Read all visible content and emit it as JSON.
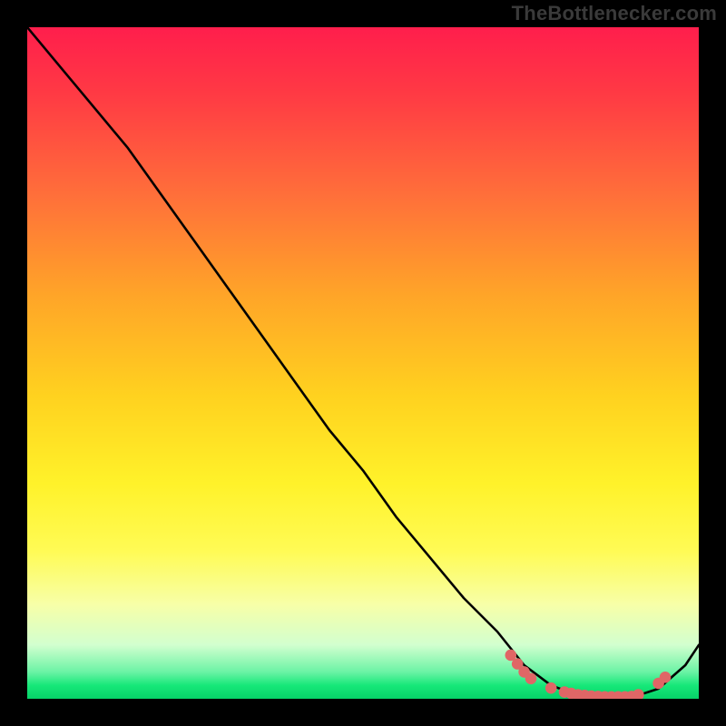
{
  "watermark": "TheBottlenecker.com",
  "chart_data": {
    "type": "line",
    "title": "",
    "xlabel": "",
    "ylabel": "",
    "xlim": [
      0,
      100
    ],
    "ylim": [
      0,
      100
    ],
    "grid": false,
    "legend": false,
    "series": [
      {
        "name": "bottleneck-curve",
        "color": "#000000",
        "x": [
          0,
          5,
          10,
          15,
          20,
          25,
          30,
          35,
          40,
          45,
          50,
          55,
          60,
          65,
          70,
          74,
          78,
          82,
          86,
          90,
          94,
          98,
          100
        ],
        "y": [
          100,
          94,
          88,
          82,
          75,
          68,
          61,
          54,
          47,
          40,
          34,
          27,
          21,
          15,
          10,
          5,
          2,
          0.5,
          0.2,
          0.2,
          1.5,
          5,
          8
        ]
      }
    ],
    "markers": {
      "name": "highlight-dots",
      "color": "#e06666",
      "x": [
        72,
        73,
        74,
        75,
        78,
        80,
        81,
        82,
        83,
        84,
        85,
        86,
        87,
        88,
        89,
        90,
        91,
        94,
        95
      ],
      "y": [
        6.5,
        5.2,
        4.0,
        3.0,
        1.6,
        1.0,
        0.8,
        0.6,
        0.5,
        0.4,
        0.35,
        0.3,
        0.3,
        0.3,
        0.3,
        0.35,
        0.6,
        2.3,
        3.2
      ]
    },
    "gradient_stops": [
      {
        "pct": 0,
        "color": "#ff1e4c"
      },
      {
        "pct": 25,
        "color": "#ff6f3a"
      },
      {
        "pct": 55,
        "color": "#ffd21f"
      },
      {
        "pct": 78,
        "color": "#fffb55"
      },
      {
        "pct": 96,
        "color": "#6bf3a5"
      },
      {
        "pct": 100,
        "color": "#06d268"
      }
    ]
  }
}
